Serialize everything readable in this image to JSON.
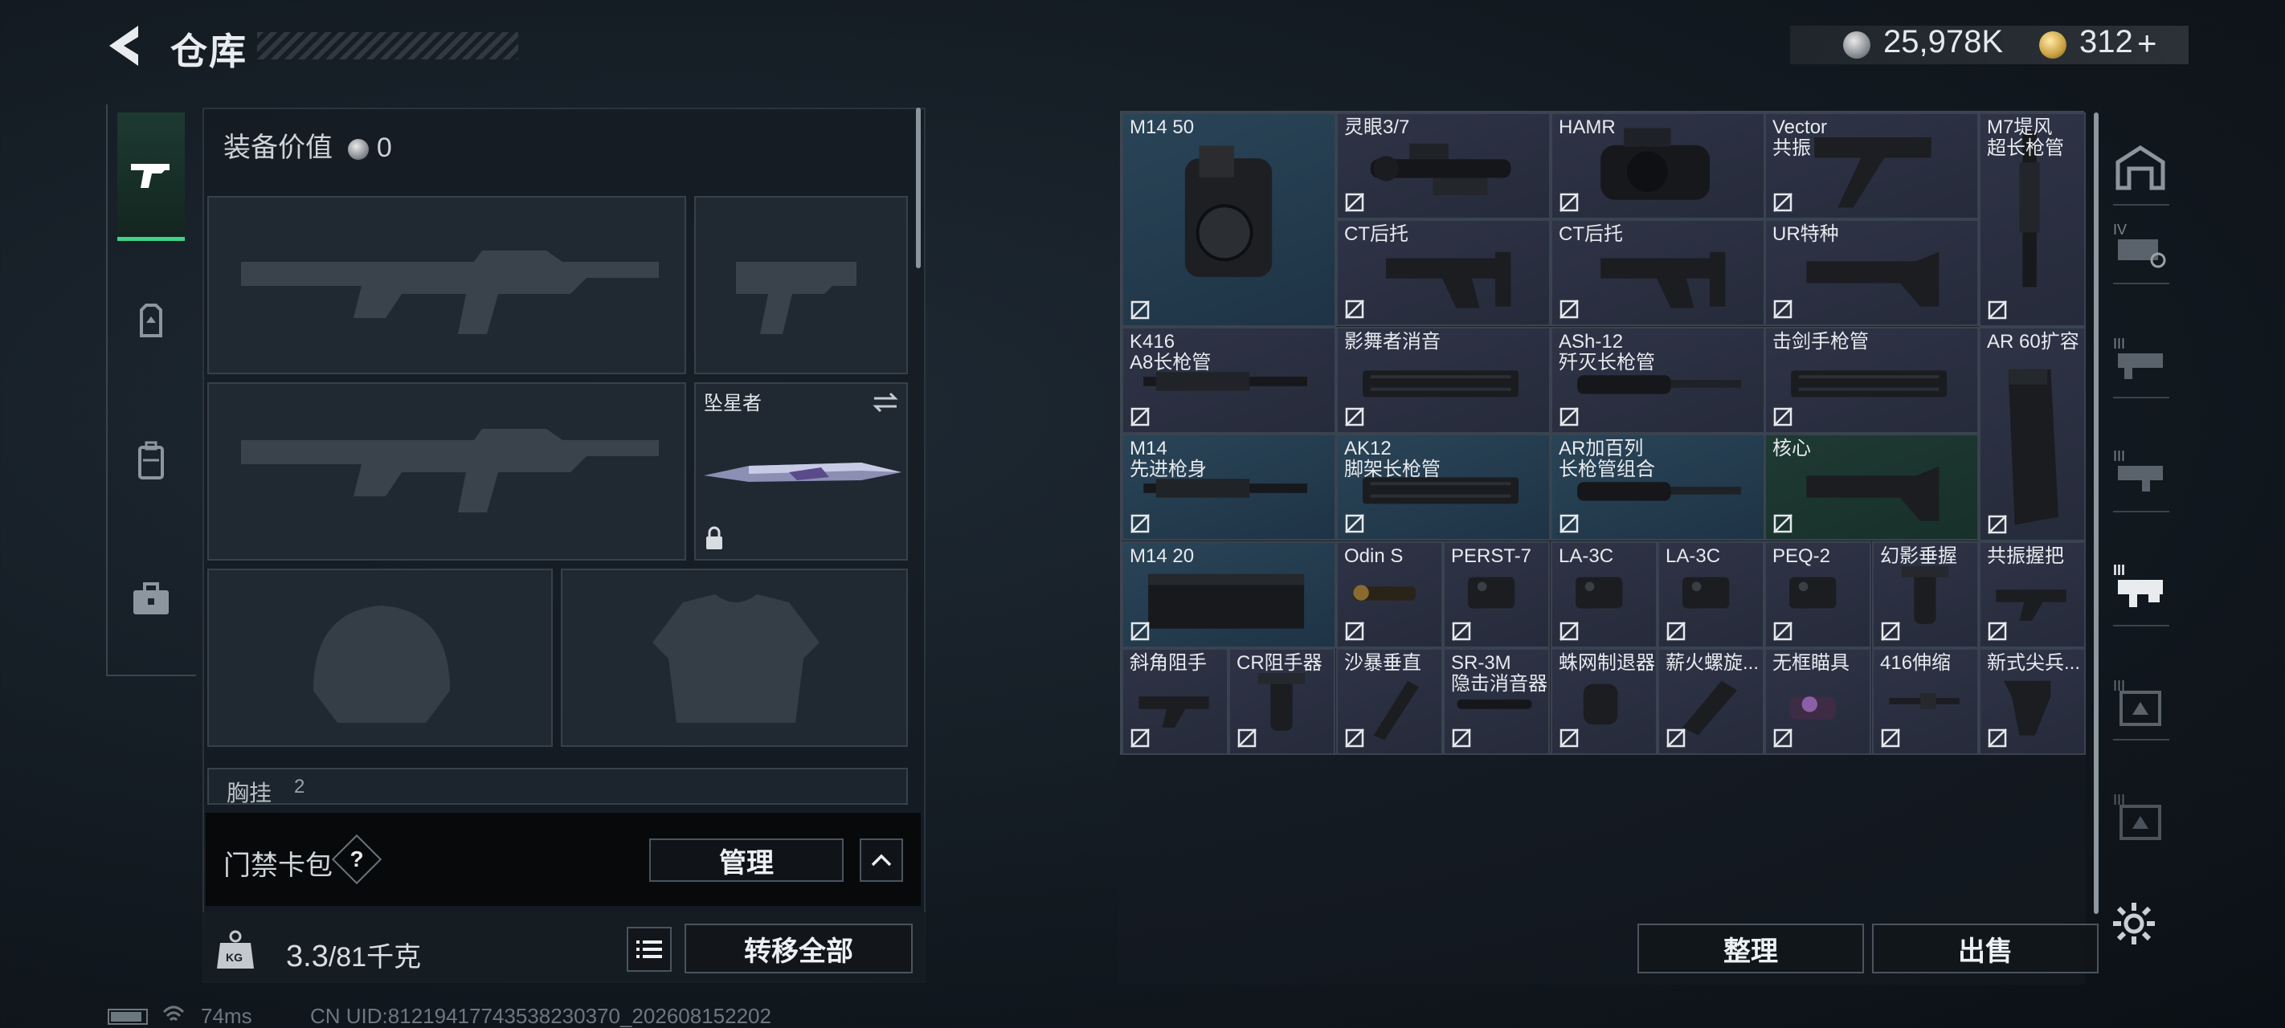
{
  "header": {
    "title": "仓库",
    "silver_amount": "25,978K",
    "gold_amount": "312",
    "gold_plus": "+"
  },
  "equipment": {
    "value_label": "装备价值",
    "value_amount": "0",
    "melee_name": "坠星者",
    "chest_label": "胸挂",
    "chest_count": "2"
  },
  "access_card": {
    "label": "门禁卡包",
    "help": "?",
    "manage_label": "管理"
  },
  "weight": {
    "current": "3.3",
    "capacity": "/81千克",
    "kg_icon_text": "KG",
    "transfer_all_label": "转移全部"
  },
  "status": {
    "ping": "74ms",
    "uid": "CN UID:81219417743538230370_202608152202"
  },
  "inventory": {
    "sort_label": "整理",
    "sell_label": "出售",
    "items": [
      {
        "name": "M14 50"
      },
      {
        "name": "灵眼3/7"
      },
      {
        "name": "HAMR"
      },
      {
        "name": "Vector\n共振"
      },
      {
        "name": "M7堤风\n超长枪管"
      },
      {
        "name": "CT后托"
      },
      {
        "name": "CT后托"
      },
      {
        "name": "UR特种"
      },
      {
        "name": "K416\nA8长枪管"
      },
      {
        "name": "影舞者消音"
      },
      {
        "name": "ASh-12\n歼灭长枪管"
      },
      {
        "name": "击剑手枪管"
      },
      {
        "name": "AR 60扩容"
      },
      {
        "name": "M14\n先进枪身"
      },
      {
        "name": "AK12\n脚架长枪管"
      },
      {
        "name": "AR加百列\n长枪管组合"
      },
      {
        "name": "核心"
      },
      {
        "name": "M14 20"
      },
      {
        "name": "Odin S"
      },
      {
        "name": "PERST-7"
      },
      {
        "name": "LA-3C"
      },
      {
        "name": "LA-3C"
      },
      {
        "name": "PEQ-2"
      },
      {
        "name": "幻影垂握"
      },
      {
        "name": "共振握把"
      },
      {
        "name": "斜角阻手"
      },
      {
        "name": "CR阻手器"
      },
      {
        "name": "沙暴垂直"
      },
      {
        "name": "SR-3M\n隐击消音器"
      },
      {
        "name": "蛛网制退器"
      },
      {
        "name": "薪火螺旋..."
      },
      {
        "name": "无框瞄具"
      },
      {
        "name": "416伸缩"
      },
      {
        "name": "新式尖兵..."
      }
    ]
  },
  "colors": {
    "accent_green": "#3fd48a",
    "tile_slate": "#2e3346",
    "tile_blue": "#2a4457",
    "tile_green": "#1f3a33"
  }
}
